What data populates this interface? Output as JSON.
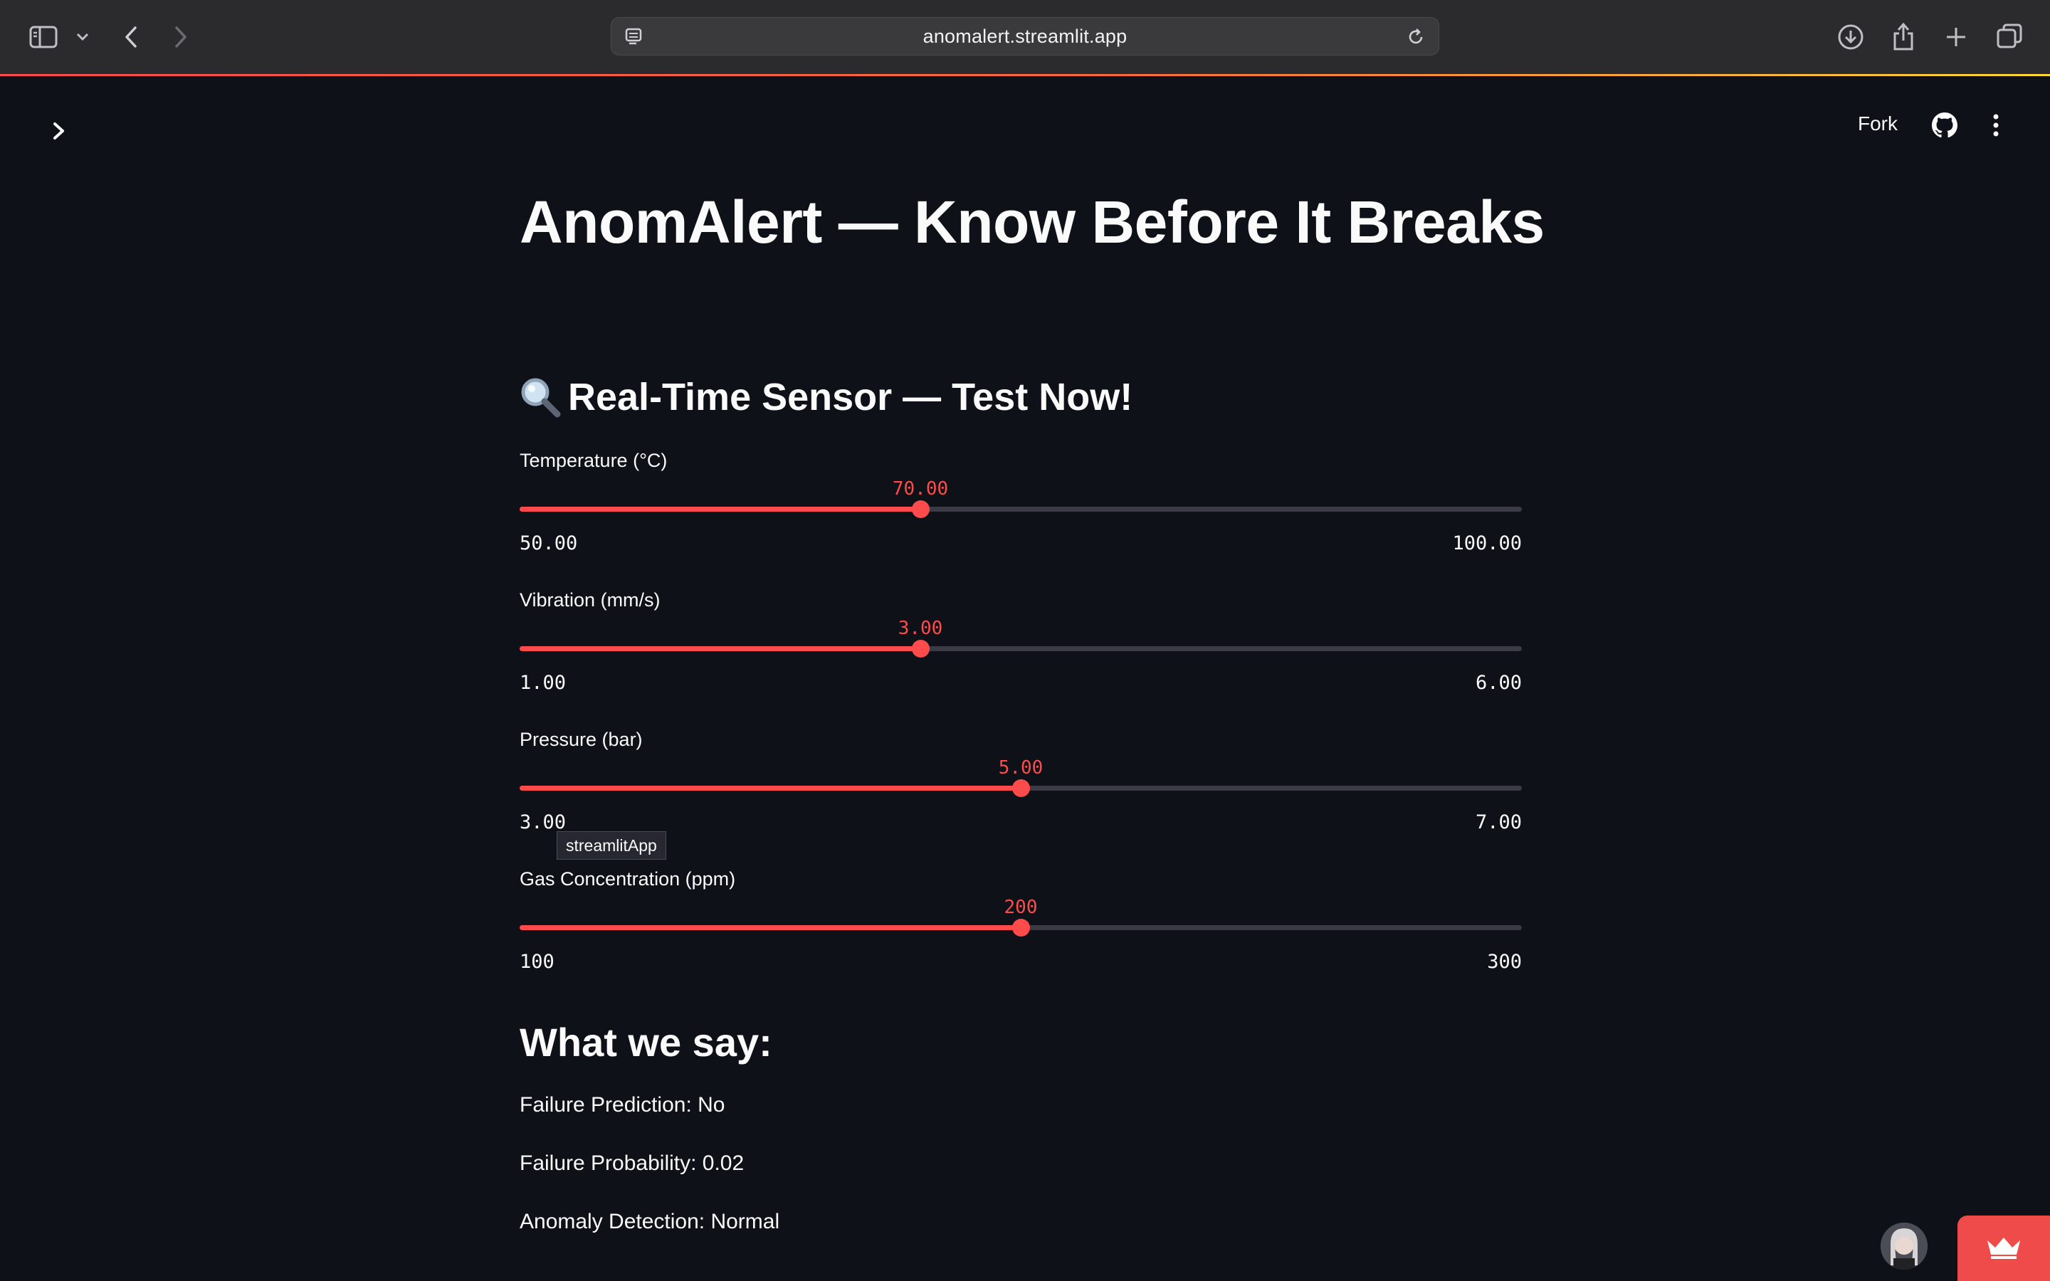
{
  "browser": {
    "url": "anomalert.streamlit.app"
  },
  "header": {
    "fork_label": "Fork"
  },
  "page": {
    "title": "AnomAlert — Know Before It Breaks",
    "section_title": "Real-Time Sensor — Test Now!",
    "section_icon": "magnifying-glass-icon"
  },
  "sliders": [
    {
      "label": "Temperature (°C)",
      "value": "70.00",
      "min": "50.00",
      "max": "100.00",
      "fraction": 0.4
    },
    {
      "label": "Vibration (mm/s)",
      "value": "3.00",
      "min": "1.00",
      "max": "6.00",
      "fraction": 0.4
    },
    {
      "label": "Pressure (bar)",
      "value": "5.00",
      "min": "3.00",
      "max": "7.00",
      "fraction": 0.5
    },
    {
      "label": "Gas Concentration (ppm)",
      "value": "200",
      "min": "100",
      "max": "300",
      "fraction": 0.5
    }
  ],
  "tooltip": {
    "text": "streamlitApp"
  },
  "results": {
    "title": "What we say:",
    "failure_prediction": "Failure Prediction: No",
    "failure_probability": "Failure Probability: 0.02",
    "anomaly_detection": "Anomaly Detection: Normal"
  },
  "colors": {
    "accent": "#ff4b4b",
    "background": "#0e1117",
    "track": "#3a3b44"
  }
}
